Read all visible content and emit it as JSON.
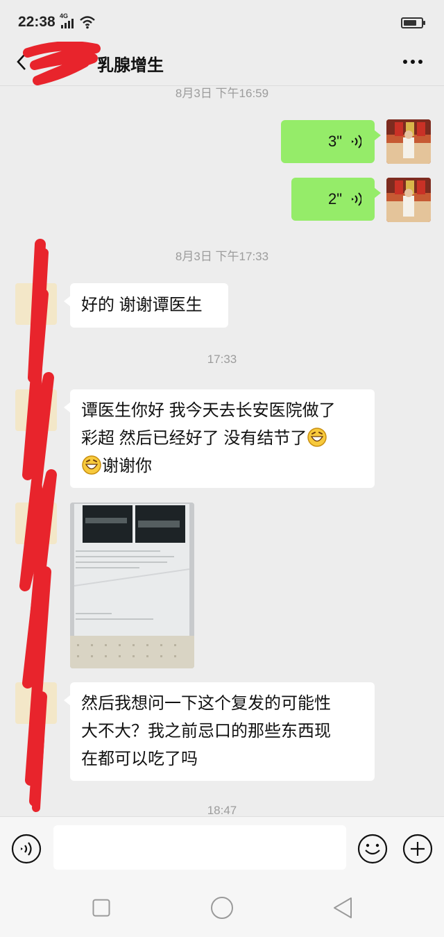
{
  "status_bar": {
    "time": "22:38",
    "network": "4G",
    "battery_level": 0.8
  },
  "header": {
    "title": "乳腺增生"
  },
  "messages": {
    "ts1": "8月3日 下午16:59",
    "voice1_duration": "3\"",
    "voice2_duration": "2\"",
    "ts2": "8月3日 下午17:33",
    "msg1": "好的  谢谢谭医生",
    "ts3": "17:33",
    "msg2_line1": "谭医生你好  我今天去长安医院做了",
    "msg2_line2": "彩超  然后已经好了  没有结节了",
    "msg2_line3": "谢谢你",
    "msg3_line1": "然后我想问一下这个复发的可能性",
    "msg3_line2": "大不大？我之前忌口的那些东西现",
    "msg3_line3": "在都可以吃了吗",
    "ts4": "18:47"
  },
  "input": {
    "value": "",
    "placeholder": ""
  },
  "colors": {
    "background": "#ededed",
    "sent_bubble": "#95ec69",
    "received_bubble": "#ffffff",
    "timestamp": "#9c9c9c",
    "redaction": "#e8242c"
  },
  "icons": {
    "back": "chevron-left-icon",
    "more": "more-icon",
    "voice": "voice-wave-icon",
    "emoji": "grinning-emoji-icon",
    "voice_toggle": "voice-input-icon",
    "emoji_panel": "smiley-icon",
    "plus": "plus-icon"
  }
}
